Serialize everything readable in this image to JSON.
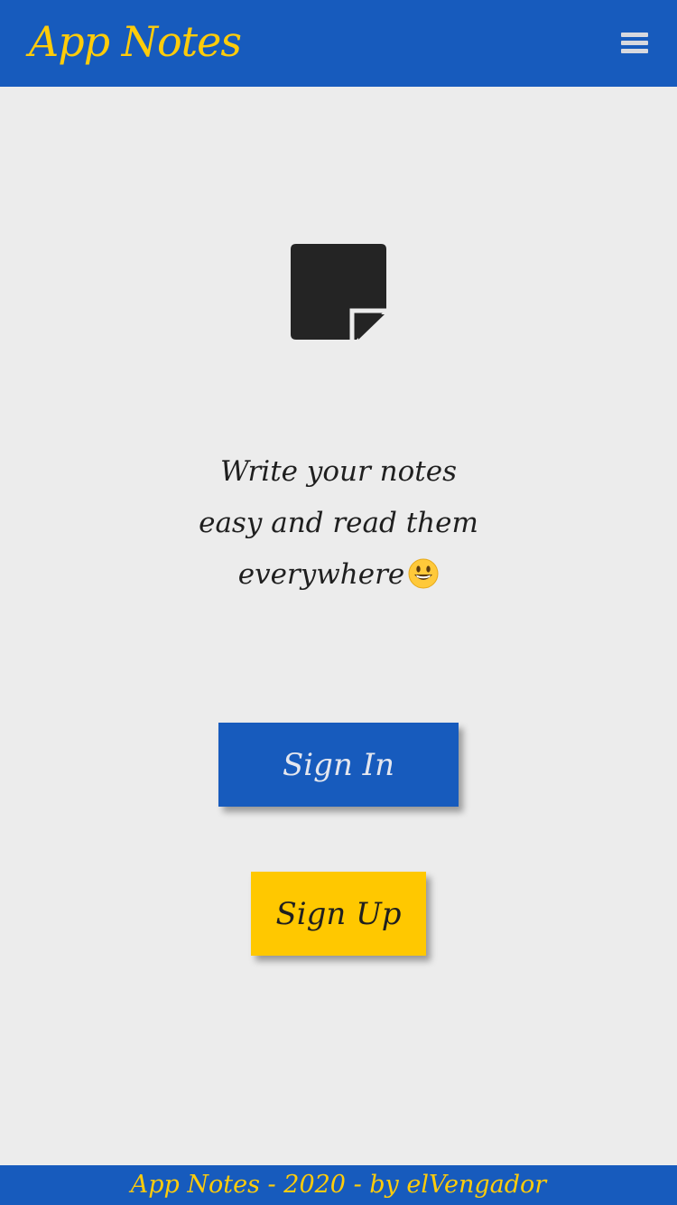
{
  "header": {
    "title": "App Notes",
    "menu_icon": "hamburger-menu-icon"
  },
  "hero": {
    "icon": "sticky-note-icon",
    "tagline_lines": [
      "Write your notes",
      "easy and read them",
      "everywhere"
    ],
    "tagline_emoji": "😃"
  },
  "actions": {
    "sign_in_label": "Sign In",
    "sign_up_label": "Sign Up"
  },
  "footer": {
    "text": "App Notes - 2020 - by elVengador"
  },
  "colors": {
    "primary": "#175bbd",
    "accent": "#ffc800",
    "background": "#ececec"
  }
}
